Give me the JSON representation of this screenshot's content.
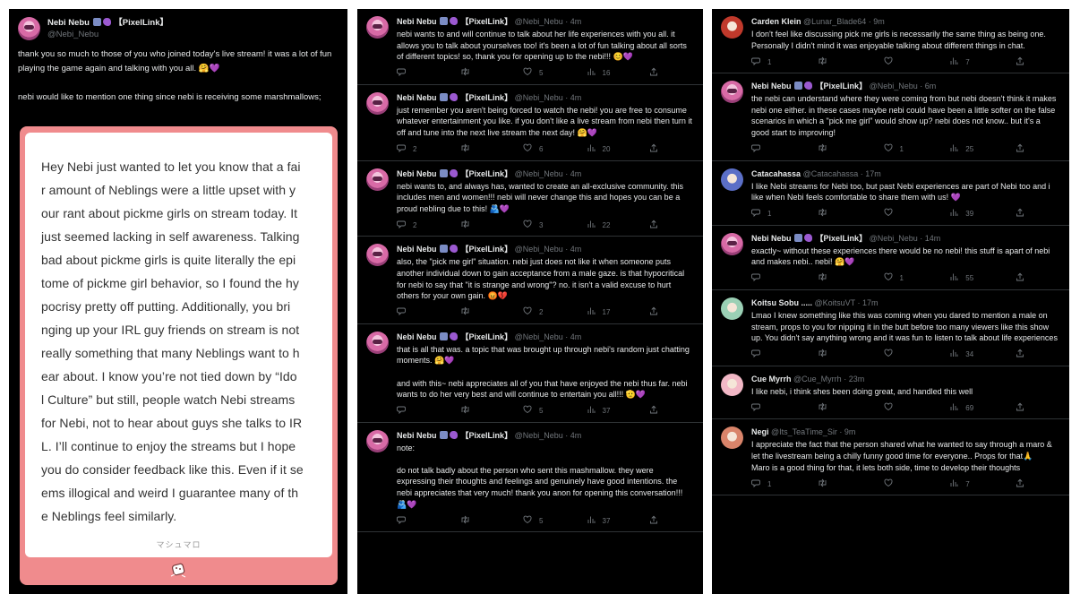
{
  "panel1": {
    "author": {
      "name": "Nebi Nebu",
      "tag": "【PixelLink】",
      "handle": "@Nebi_Nebu"
    },
    "paragraphs": [
      "thank you so much to those of you who joined today's live stream! it was a lot of fun playing the game again and talking with you all. 🤗💜",
      "nebi would like to mention one thing since nebi is receiving some marshmallows;"
    ],
    "marshmallow": {
      "lines": [
        "Hey Nebi just wanted to let you know that a fai",
        "r amount of Neblings were a little upset with y",
        "our rant about pickme girls on stream today. It",
        "just seemed lacking in self awareness. Talking",
        "bad about pickme girls is quite literally the epi",
        "tome of pickme girl behavior, so I found the hy",
        "pocrisy pretty off putting. Additionally, you bri",
        "nging up your IRL guy friends on stream is not",
        "really something that many Neblings want to h",
        "ear about. I know you’re not tied down by “Ido",
        "l Culture” but still, people watch Nebi streams",
        "for Nebi, not to hear about guys she talks to IR",
        "L. I’ll continue to enjoy the streams but I hope",
        "you do consider feedback like this. Even if it se",
        "ems illogical and weird I guarantee many of th",
        "e Neblings feel similarly."
      ],
      "brand": "マシュマロ"
    }
  },
  "panel2": {
    "tweets": [
      {
        "name": "Nebi Nebu",
        "tag": "【PixelLink】",
        "handle": "@Nebi_Nebu",
        "time": "· 4m",
        "text": "nebi wants to and will continue to talk about her life experiences with you all. it allows you to talk about yourselves too! it's been a lot of fun talking about all sorts of different topics! so, thank you for opening up to the nebi!!! 😊💜",
        "replies": "",
        "retweets": "",
        "likes": "5",
        "views": "16"
      },
      {
        "name": "Nebi Nebu",
        "tag": "【PixelLink】",
        "handle": "@Nebi_Nebu",
        "time": "· 4m",
        "text": "just remember you aren't being forced to watch the nebi! you are free to consume whatever entertainment you like. if you don't like a live stream from nebi then turn it off and tune into the next live stream the next day! 🤗💜",
        "replies": "2",
        "retweets": "",
        "likes": "6",
        "views": "20"
      },
      {
        "name": "Nebi Nebu",
        "tag": "【PixelLink】",
        "handle": "@Nebi_Nebu",
        "time": "· 4m",
        "text": "nebi wants to, and always has, wanted to create an all-exclusive community. this includes men and women!!! nebi will never change this and hopes you can be a proud nebling due to this! 🫂💜",
        "replies": "2",
        "retweets": "",
        "likes": "3",
        "views": "22"
      },
      {
        "name": "Nebi Nebu",
        "tag": "【PixelLink】",
        "handle": "@Nebi_Nebu",
        "time": "· 4m",
        "text": "also, the \"pick me girl\" situation. nebi just does not like it when someone puts another individual down to gain acceptance from a male gaze. is that hypocritical for nebi to say that \"it is strange and wrong\"? no. it isn't a valid excuse to hurt others for your own gain. 😡💔",
        "replies": "",
        "retweets": "",
        "likes": "2",
        "views": "17"
      },
      {
        "name": "Nebi Nebu",
        "tag": "【PixelLink】",
        "handle": "@Nebi_Nebu",
        "time": "· 4m",
        "text": "that is all that was. a topic that was brought up through nebi's random just chatting moments. 🤗💜\n\nand with this~ nebi appreciates all of you that have enjoyed the nebi thus far. nebi wants to do her very best and will continue to entertain you all!!! 🫡💜",
        "replies": "",
        "retweets": "",
        "likes": "5",
        "views": "37"
      },
      {
        "name": "Nebi Nebu",
        "tag": "【PixelLink】",
        "handle": "@Nebi_Nebu",
        "time": "· 4m",
        "text": "note:\n\ndo not talk badly about the person who sent this mashmallow. they were expressing their thoughts and feelings and genuinely have good intentions. the nebi appreciates that very much! thank you anon for opening this conversation!!! 🫂💜",
        "replies": "",
        "retweets": "",
        "likes": "5",
        "views": "37"
      }
    ]
  },
  "panel3": {
    "tweets": [
      {
        "name": "Carden Klein",
        "tag": "",
        "handle": "@Lunar_Blade64",
        "time": "· 9m",
        "avatar": "#c0392b",
        "text": "I don't feel like discussing pick me girls is necessarily the same thing as being one. Personally I didn't mind it was enjoyable talking about different things in chat.",
        "replies": "1",
        "retweets": "",
        "likes": "",
        "views": "7"
      },
      {
        "name": "Nebi Nebu",
        "tag": "【PixelLink】",
        "handle": "@Nebi_Nebu",
        "time": "· 6m",
        "avatar": "nebi",
        "text": "the nebi can understand where they were coming from but nebi doesn't think it makes nebi one either. in these cases maybe nebi could have been a little softer on the false scenarios in which a \"pick me girl\" would show up? nebi does not know.. but it's a good start to improving!",
        "replies": "",
        "retweets": "",
        "likes": "1",
        "views": "25"
      },
      {
        "name": "Catacahassa",
        "tag": "",
        "handle": "@Catacahassa",
        "time": "· 17m",
        "avatar": "#5b6fc7",
        "text": "I like Nebi streams for Nebi too, but past Nebi experiences are part of Nebi too and i like when Nebi feels comfortable to share them with us! 💜",
        "replies": "1",
        "retweets": "",
        "likes": "",
        "views": "39"
      },
      {
        "name": "Nebi Nebu",
        "tag": "【PixelLink】",
        "handle": "@Nebi_Nebu",
        "time": "· 14m",
        "avatar": "nebi",
        "text": "exactly~ without these experiences there would be no nebi! this stuff is apart of nebi and makes nebi.. nebi! 🤗💜",
        "replies": "",
        "retweets": "",
        "likes": "1",
        "views": "55"
      },
      {
        "name": "Koitsu Sobu .....",
        "tag": "",
        "handle": "@KoitsuVT",
        "time": "· 17m",
        "avatar": "#9bd0b5",
        "text": "Lmao I knew something like this was coming when you dared to mention a male on stream, props to you for nipping it in the butt before too many viewers like this show up. You didn't say anything wrong and it was fun to listen to talk about life experiences",
        "replies": "",
        "retweets": "",
        "likes": "",
        "views": "34"
      },
      {
        "name": "Cue Myrrh",
        "tag": "",
        "handle": "@Cue_Myrrh",
        "time": "· 23m",
        "avatar": "#f2b8c6",
        "text": "I like nebi, i think shes been doing great, and handled this well",
        "replies": "",
        "retweets": "",
        "likes": "",
        "views": "69"
      },
      {
        "name": "Negi",
        "tag": "",
        "handle": "@Its_TeaTime_Sir",
        "time": "· 9m",
        "avatar": "#d9846a",
        "text": "I appreciate the fact that the person shared what he wanted to say through a maro & let the livestream being a chilly funny good time for everyone.. Props for that🙏\nMaro is a good thing for that, it lets both side, time to develop their thoughts",
        "replies": "1",
        "retweets": "",
        "likes": "",
        "views": "7"
      }
    ]
  },
  "icons": {
    "reply": "reply-icon",
    "retweet": "retweet-icon",
    "like": "heart-icon",
    "views": "views-icon",
    "share": "share-icon"
  }
}
